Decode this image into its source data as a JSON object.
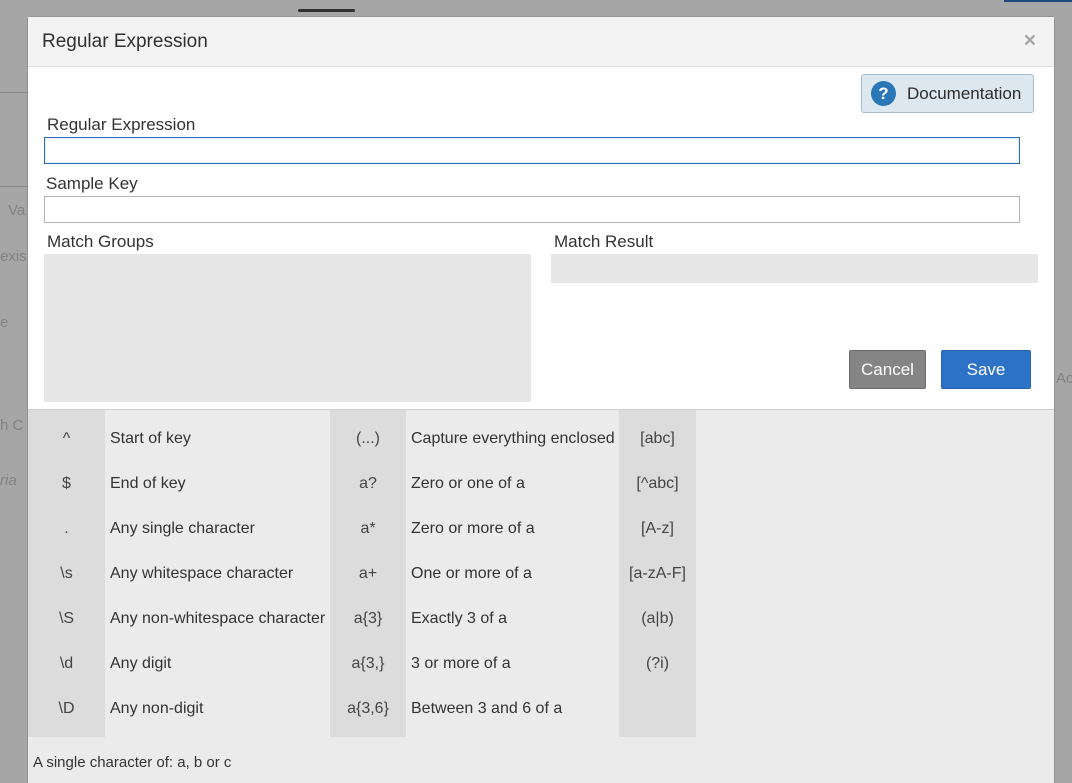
{
  "background": {
    "fragments": [
      "Va",
      "exis",
      "e",
      "Ac",
      "h C",
      "ria"
    ]
  },
  "dialog": {
    "title": "Regular Expression",
    "close_glyph": "×",
    "documentation_button": {
      "icon": "?",
      "label": "Documentation"
    },
    "regex_field": {
      "label": "Regular Expression",
      "value": ""
    },
    "sample_key_field": {
      "label": "Sample Key",
      "value": ""
    },
    "match_groups": {
      "label": "Match Groups"
    },
    "match_result": {
      "label": "Match Result"
    },
    "cancel_label": "Cancel",
    "save_label": "Save"
  },
  "reference": {
    "rows": [
      [
        "^",
        "Start of key",
        "(...)",
        "Capture everything enclosed",
        "[abc]"
      ],
      [
        "$",
        "End of key",
        "a?",
        "Zero or one of a",
        "[^abc]"
      ],
      [
        ".",
        "Any single character",
        "a*",
        "Zero or more of a",
        "[A-z]"
      ],
      [
        "\\s",
        "Any whitespace character",
        "a+",
        "One or more of a",
        "[a-zA-F]"
      ],
      [
        "\\S",
        "Any non-whitespace character",
        "a{3}",
        "Exactly 3 of a",
        "(a|b)"
      ],
      [
        "\\d",
        "Any digit",
        "a{3,}",
        "3 or more of a",
        "(?i)"
      ],
      [
        "\\D",
        "Any non-digit",
        "a{3,6}",
        "Between 3 and 6 of a",
        ""
      ]
    ],
    "status_text": "A single character of: a, b or c"
  }
}
